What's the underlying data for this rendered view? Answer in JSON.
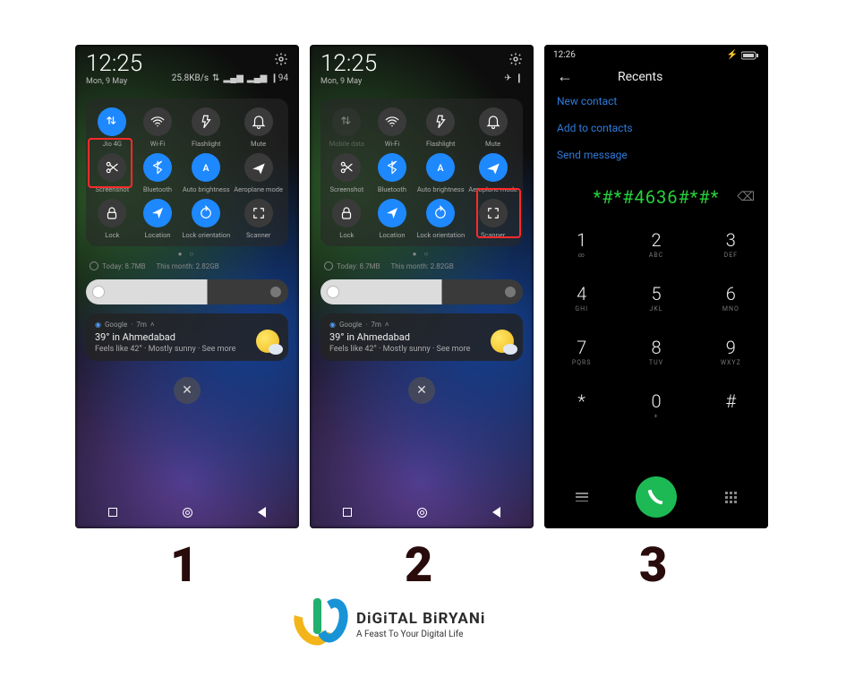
{
  "steps": {
    "one": "1",
    "two": "2",
    "three": "3"
  },
  "brand": {
    "name": "DiGiTAL BiRYANi",
    "tagline": "A Feast To Your Digital Life"
  },
  "shade": {
    "time": "12:25",
    "date": "Mon, 9 May",
    "status_text": "25.8KB/s",
    "tiles": [
      {
        "id": "data",
        "label": "Jio 4G",
        "label_off": "Mobile data",
        "icon": "updown"
      },
      {
        "id": "wifi",
        "label": "Wi-Fi",
        "icon": "wifi"
      },
      {
        "id": "flash",
        "label": "Flashlight",
        "icon": "flash"
      },
      {
        "id": "mute",
        "label": "Mute",
        "icon": "bell"
      },
      {
        "id": "sshot",
        "label": "Screenshot",
        "icon": "scissors"
      },
      {
        "id": "bt",
        "label": "Bluetooth",
        "icon": "bt"
      },
      {
        "id": "autob",
        "label": "Auto brightness",
        "icon": "A"
      },
      {
        "id": "air",
        "label": "Aeroplane mode",
        "icon": "plane"
      },
      {
        "id": "lock",
        "label": "Lock",
        "icon": "lock"
      },
      {
        "id": "loc",
        "label": "Location",
        "icon": "nav"
      },
      {
        "id": "lori",
        "label": "Lock orientation",
        "icon": "rot"
      },
      {
        "id": "scan",
        "label": "Scanner",
        "icon": "scan"
      }
    ],
    "data_usage_today": "Today: 8.7MB",
    "data_usage_month": "This month: 2.82GB",
    "notification": {
      "app": "Google",
      "age": "7m",
      "title": "39° in Ahmedabad",
      "subtitle": "Feels like 42° · Mostly sunny · See more"
    }
  },
  "dialer": {
    "status_time": "12:26",
    "title": "Recents",
    "links": {
      "new_contact": "New contact",
      "add": "Add to contacts",
      "send": "Send message"
    },
    "entered": "*#*#4636#*#*",
    "keys": [
      {
        "n": "1",
        "s": "∞"
      },
      {
        "n": "2",
        "s": "ABC"
      },
      {
        "n": "3",
        "s": "DEF"
      },
      {
        "n": "4",
        "s": "GHI"
      },
      {
        "n": "5",
        "s": "JKL"
      },
      {
        "n": "6",
        "s": "MNO"
      },
      {
        "n": "7",
        "s": "PQRS"
      },
      {
        "n": "8",
        "s": "TUV"
      },
      {
        "n": "9",
        "s": "WXYZ"
      },
      {
        "n": "*",
        "s": ""
      },
      {
        "n": "0",
        "s": "+"
      },
      {
        "n": "#",
        "s": ""
      }
    ]
  }
}
